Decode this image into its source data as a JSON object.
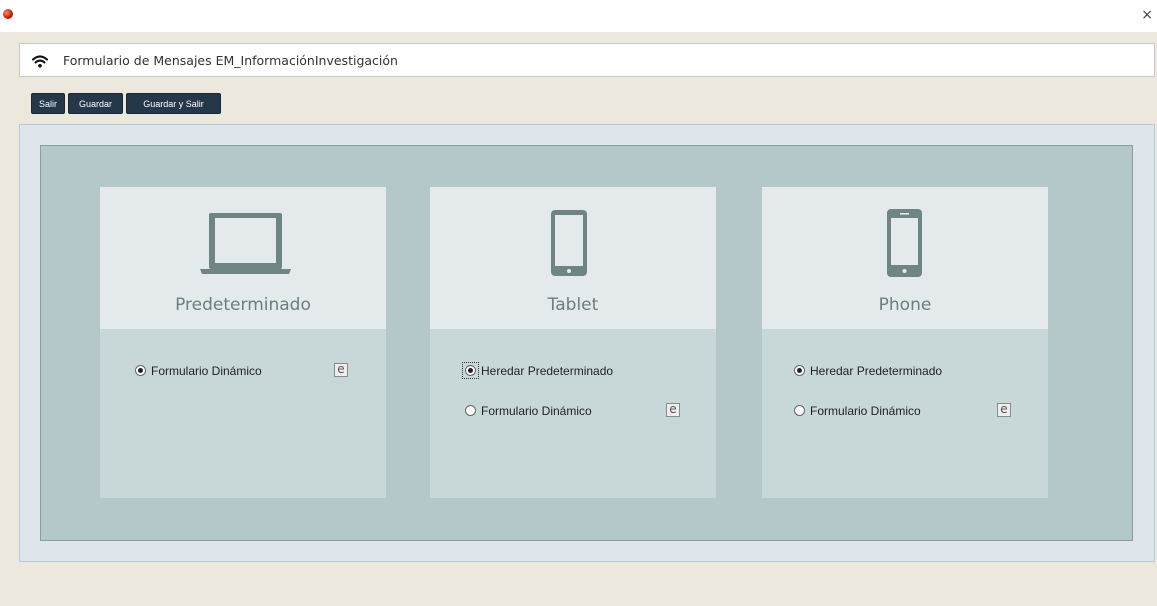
{
  "window": {
    "close_glyph": "×"
  },
  "header": {
    "icon": "wifi-icon",
    "title": "Formulario de Mensajes EM_InformaciónInvestigación"
  },
  "toolbar": {
    "salir_label": "Salir",
    "guardar_label": "Guardar",
    "guardar_salir_label": "Guardar y Salir"
  },
  "cards": {
    "default": {
      "icon": "laptop-icon",
      "label": "Predeterminado",
      "options": [
        {
          "label": "Formulario Dinámico",
          "selected": true,
          "edit_glyph": "e"
        }
      ]
    },
    "tablet": {
      "icon": "tablet-icon",
      "label": "Tablet",
      "options": [
        {
          "label": "Heredar Predeterminado",
          "selected": true
        },
        {
          "label": "Formulario Dinámico",
          "selected": false,
          "edit_glyph": "e"
        }
      ]
    },
    "phone": {
      "icon": "phone-icon",
      "label": "Phone",
      "options": [
        {
          "label": "Heredar Predeterminado",
          "selected": true
        },
        {
          "label": "Formulario Dinámico",
          "selected": false,
          "edit_glyph": "e"
        }
      ]
    }
  },
  "colors": {
    "toolbar_button": "#24384a",
    "inner_panel": "#b4c7c9",
    "card_top": "#e4eaec",
    "card_bottom": "#c8d8d9",
    "device_icon": "#6f8584"
  }
}
